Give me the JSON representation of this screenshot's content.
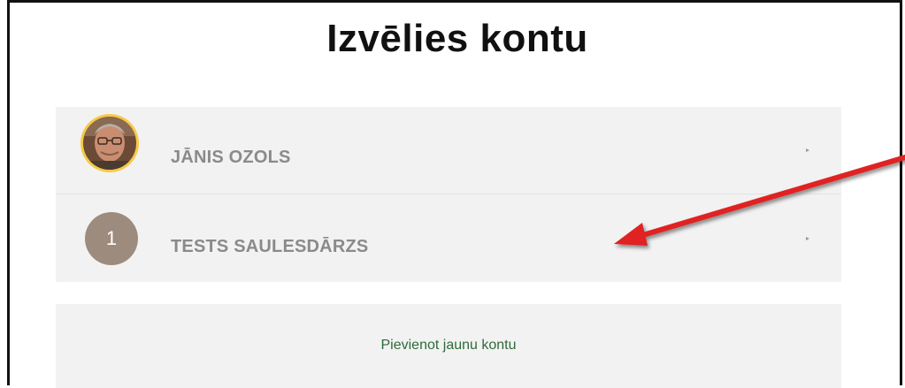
{
  "page": {
    "title": "Izvēlies kontu"
  },
  "accounts": [
    {
      "name": "JĀNIS OZOLS",
      "avatar": "photo-avatar"
    },
    {
      "name": "TESTS SAULESDĀRZS",
      "avatar_number": "1"
    }
  ],
  "add_account": {
    "label": "Pievienot jaunu kontu"
  },
  "colors": {
    "list_background": "#f2f2f2",
    "name_text": "#8a8a8a",
    "link_text": "#2e6b3a",
    "number_avatar": "#9d8b7e",
    "photo_ring": "#f7c948",
    "annotation_arrow": "#e02020"
  }
}
